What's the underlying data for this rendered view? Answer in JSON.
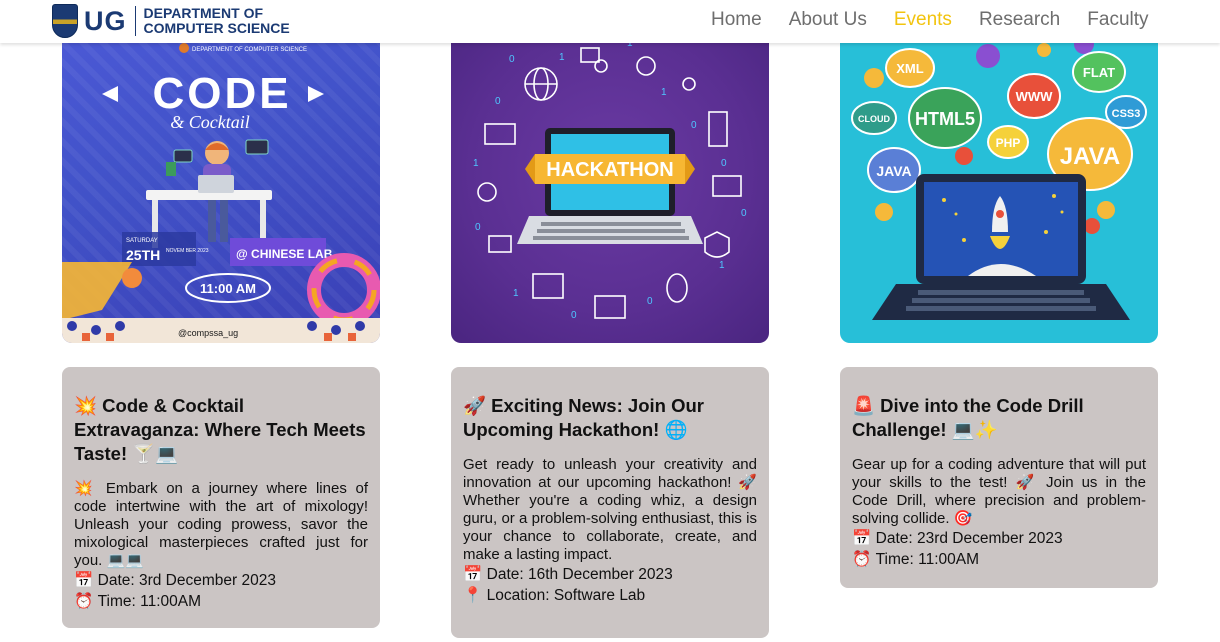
{
  "header": {
    "logo_short": "UG",
    "logo_line1": "DEPARTMENT OF",
    "logo_line2": "COMPUTER SCIENCE",
    "nav": [
      {
        "label": "Home",
        "active": false
      },
      {
        "label": "About Us",
        "active": false
      },
      {
        "label": "Events",
        "active": true
      },
      {
        "label": "Research",
        "active": false
      },
      {
        "label": "Faculty",
        "active": false
      }
    ],
    "accent_color": "#f2c40f"
  },
  "events": [
    {
      "poster": {
        "dept": "DEPARTMENT OF COMPUTER SCIENCE",
        "title": "CODE",
        "subtitle": "& Cocktail",
        "day_label": "SATURDAY",
        "date_big": "25TH",
        "date_rest": "NOVEM BER 2023",
        "venue": "@ CHINESE LAB",
        "time": "11:00 AM",
        "handle": "@compssa_ug"
      },
      "title": "💥 Code & Cocktail Extravaganza: Where Tech Meets Taste! 🍸💻",
      "description": "💥 Embark on a journey where lines of code intertwine with the art of mixology! Unleash your coding prowess, savor the mixological masterpieces crafted just for you. 💻💻",
      "lines": [
        {
          "icon": "📅",
          "text": "Date: 3rd December 2023"
        },
        {
          "icon": "⏰",
          "text": "Time: 11:00AM"
        }
      ]
    },
    {
      "poster": {
        "banner": "HACKATHON"
      },
      "title": "🚀 Exciting News: Join Our Upcoming Hackathon! 🌐",
      "description": "Get ready to unleash your creativity and innovation at our upcoming hackathon! 🚀 Whether you're a coding whiz, a design guru, or a problem-solving enthusiast, this is your chance to collaborate, create, and make a lasting impact.",
      "lines": [
        {
          "icon": "📅",
          "text": "Date: 16th December 2023"
        },
        {
          "icon": "📍",
          "text": "Location: Software Lab"
        }
      ]
    },
    {
      "poster": {
        "bubbles": [
          "XML",
          "HTML5",
          "WWW",
          "FLAT",
          "CLOUD",
          "PHP",
          "CSS3",
          "JAVA",
          "JAVA"
        ]
      },
      "title": "🚨 Dive into the Code Drill Challenge! 💻✨",
      "description": "Gear up for a coding adventure that will put your skills to the test! 🚀 Join us in the Code Drill, where precision and problem-solving collide. 🎯",
      "lines": [
        {
          "icon": "📅",
          "text": "Date: 23rd December 2023"
        },
        {
          "icon": "⏰",
          "text": "Time: 11:00AM"
        }
      ]
    }
  ]
}
